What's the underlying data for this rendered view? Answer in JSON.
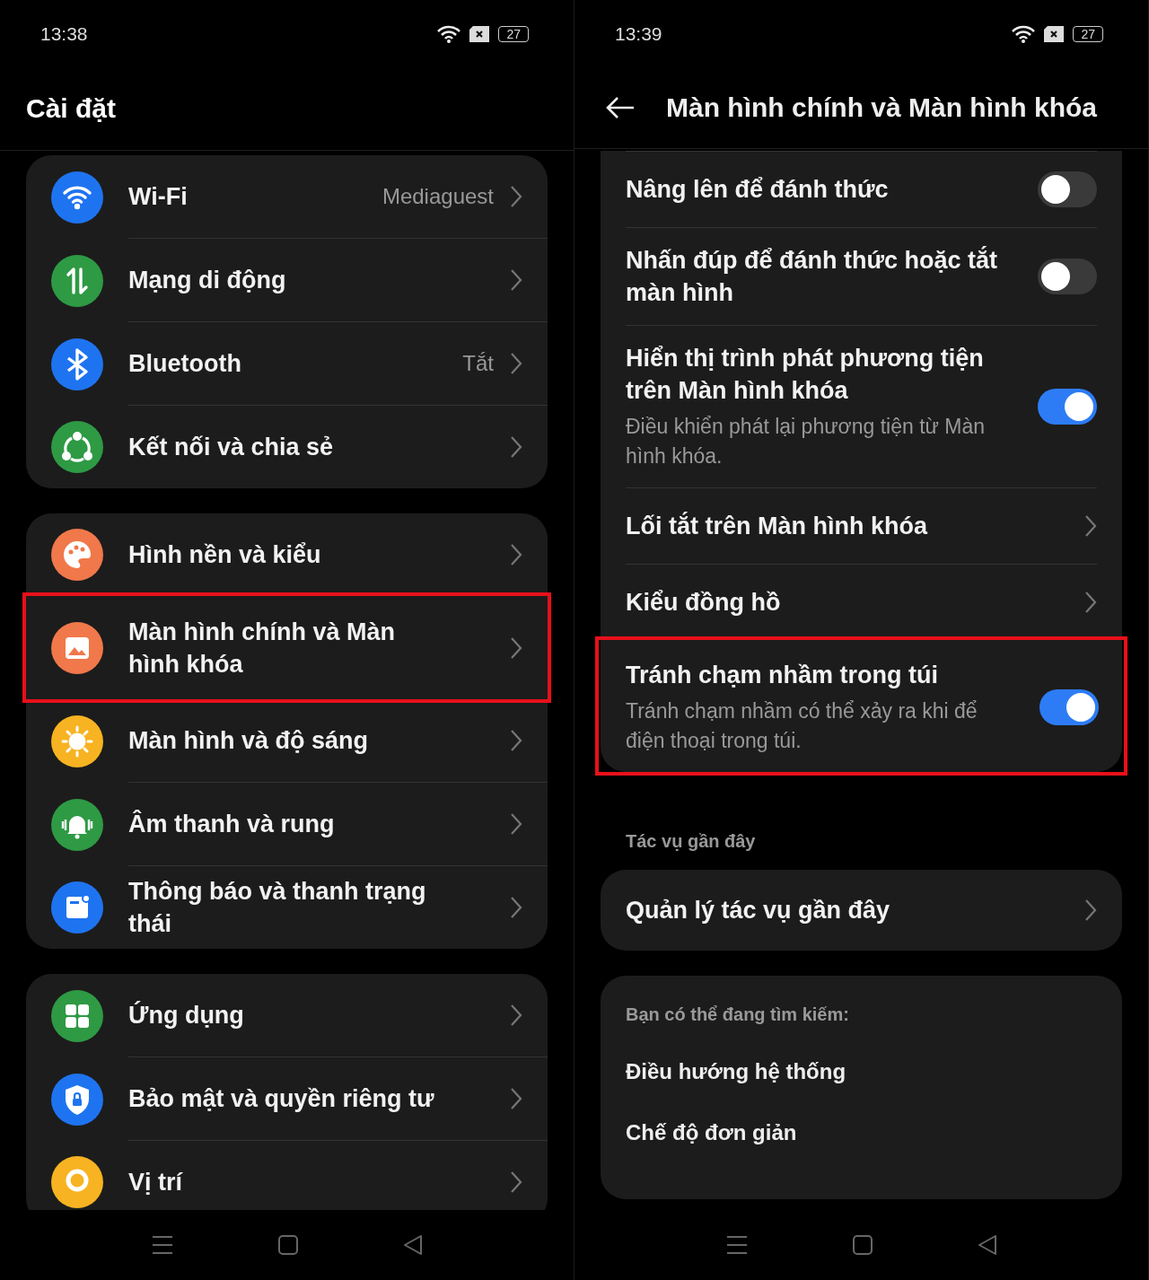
{
  "screens": [
    {
      "kind": "settings",
      "time": "13:38",
      "battery": "27",
      "title": "Cài đặt",
      "groups": [
        {
          "items": [
            {
              "label": "Wi-Fi",
              "value": "Mediaguest",
              "color": "#1e74f0",
              "highlighted": false
            },
            {
              "label": "Mạng di động",
              "color": "#2e9a44",
              "highlighted": false
            },
            {
              "label": "Bluetooth",
              "value": "Tắt",
              "color": "#1e74f0",
              "highlighted": false
            },
            {
              "label": "Kết nối và chia sẻ",
              "color": "#2e9a44",
              "highlighted": false
            }
          ]
        },
        {
          "items": [
            {
              "label": "Hình nền và kiểu",
              "color": "#f0784a",
              "highlighted": false
            },
            {
              "label": "Màn hình chính và Màn hình khóa",
              "color": "#f0784a",
              "highlighted": true
            },
            {
              "label": "Màn hình và độ sáng",
              "color": "#f7b321",
              "highlighted": false
            },
            {
              "label": "Âm thanh và rung",
              "color": "#2e9a44",
              "highlighted": false
            },
            {
              "label": "Thông báo và thanh trạng thái",
              "color": "#1e74f0",
              "highlighted": false
            }
          ]
        },
        {
          "items": [
            {
              "label": "Ứng dụng",
              "color": "#2e9a44",
              "highlighted": false
            },
            {
              "label": "Bảo mật và quyền riêng tư",
              "color": "#1e74f0",
              "highlighted": false
            },
            {
              "label": "Vị trí",
              "color": "#f7b321",
              "highlighted": false
            }
          ]
        }
      ]
    },
    {
      "kind": "detail",
      "time": "13:39",
      "battery": "27",
      "title": "Màn hình chính và Màn hình khóa",
      "rows": [
        {
          "kind": "toggle",
          "label": "Nâng lên để đánh thức",
          "on": false,
          "highlighted": false
        },
        {
          "kind": "toggle",
          "label": "Nhấn đúp để đánh thức hoặc tắt màn hình",
          "on": false,
          "highlighted": false
        },
        {
          "kind": "toggle",
          "label": "Hiển thị trình phát phương tiện trên Màn hình khóa",
          "description": "Điều khiển phát lại phương tiện từ Màn hình khóa.",
          "on": true,
          "highlighted": false
        },
        {
          "kind": "link",
          "label": "Lối tắt trên Màn hình khóa",
          "highlighted": false
        },
        {
          "kind": "link",
          "label": "Kiểu đồng hồ",
          "highlighted": false
        },
        {
          "kind": "toggle",
          "label": "Tránh chạm nhầm trong túi",
          "description": "Tránh chạm nhầm có thể xảy ra khi để điện thoại trong túi.",
          "on": true,
          "highlighted": true
        }
      ],
      "section": "Tác vụ gần đây",
      "section_rows": [
        {
          "label": "Quản lý tác vụ gần đây"
        }
      ],
      "suggestions": {
        "heading": "Bạn có thể đang tìm kiếm:",
        "items": [
          "Điều hướng hệ thống",
          "Chế độ đơn giản"
        ]
      }
    }
  ]
}
